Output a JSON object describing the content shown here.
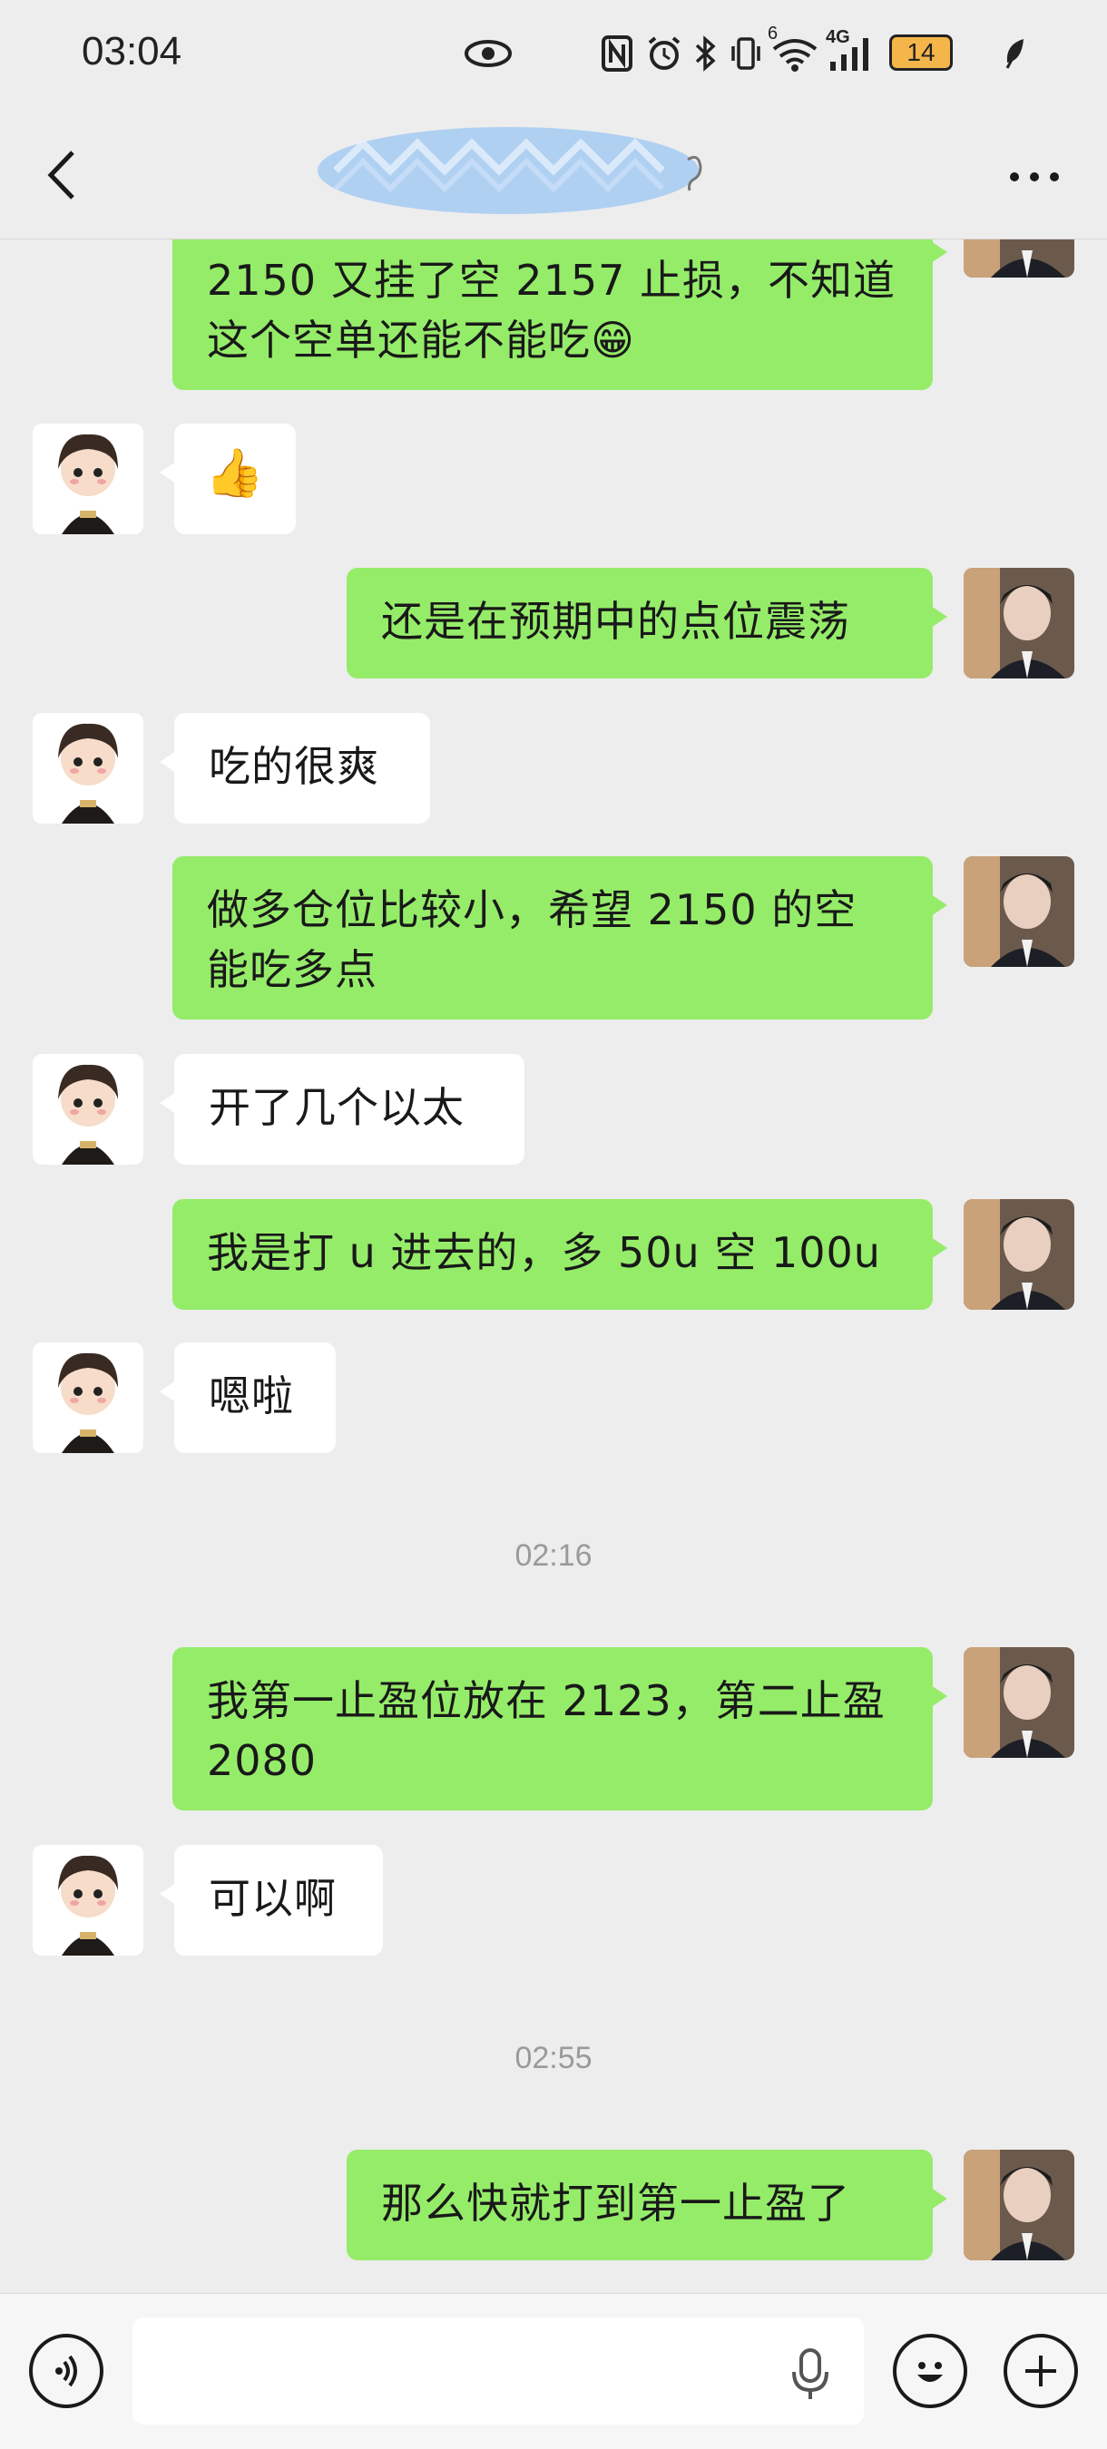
{
  "status_bar": {
    "time": "03:04",
    "battery_level": "14",
    "wifi_badge": "6",
    "network_type": "4G",
    "icons": [
      "eye-icon",
      "nfc-icon",
      "alarm-icon",
      "bluetooth-icon",
      "vibrate-icon",
      "wifi-icon",
      "signal-icon",
      "battery-icon",
      "leaf-icon"
    ]
  },
  "header": {
    "contact_name": "",
    "back_icon": "chevron-left-icon",
    "more_icon": "more-dots-icon"
  },
  "messages": [
    {
      "side": "me",
      "text": "2150 又挂了空 2157 止损，不知道这个空单还能不能吃😁"
    },
    {
      "side": "other",
      "text": "👍"
    },
    {
      "side": "me",
      "text": "还是在预期中的点位震荡"
    },
    {
      "side": "other",
      "text": "吃的很爽"
    },
    {
      "side": "me",
      "text": "做多仓位比较小，希望 2150 的空能吃多点"
    },
    {
      "side": "other",
      "text": "开了几个以太"
    },
    {
      "side": "me",
      "text": "我是打 u 进去的，多 50u 空 100u"
    },
    {
      "side": "other",
      "text": "嗯啦"
    },
    {
      "side": "timestamp",
      "text": "02:16"
    },
    {
      "side": "me",
      "text": "我第一止盈位放在 2123，第二止盈 2080"
    },
    {
      "side": "other",
      "text": "可以啊"
    },
    {
      "side": "timestamp",
      "text": "02:55"
    },
    {
      "side": "me",
      "text": "那么快就打到第一止盈了"
    }
  ],
  "input_bar": {
    "voice_icon": "voice-icon",
    "placeholder": "",
    "mic_icon": "microphone-icon",
    "emoji_icon": "emoji-icon",
    "plus_icon": "plus-icon"
  },
  "colors": {
    "background": "#ededed",
    "my_bubble": "#95ec69",
    "other_bubble": "#ffffff",
    "timestamp": "#9a9a9a"
  }
}
